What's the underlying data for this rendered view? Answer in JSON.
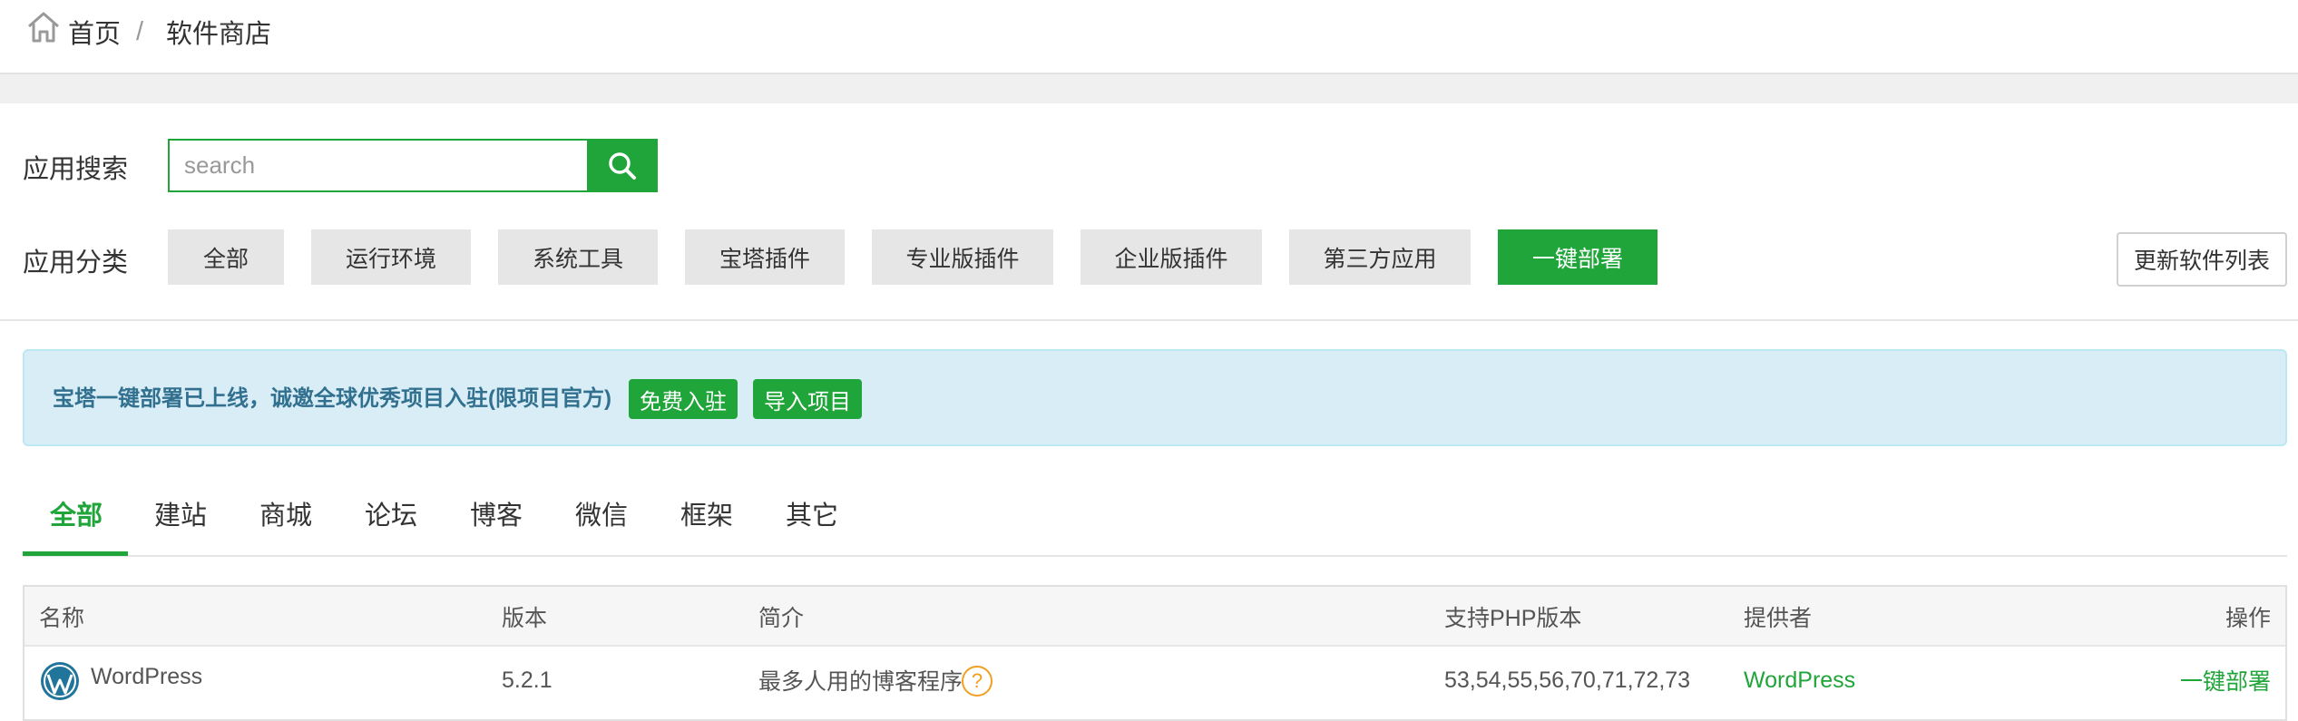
{
  "breadcrumb": {
    "home": "首页",
    "separator": "/",
    "current": "软件商店"
  },
  "search": {
    "label": "应用搜索",
    "placeholder": "search"
  },
  "categories": {
    "label": "应用分类",
    "items": [
      "全部",
      "运行环境",
      "系统工具",
      "宝塔插件",
      "专业版插件",
      "企业版插件",
      "第三方应用",
      "一键部署"
    ],
    "active": "一键部署"
  },
  "update_button": "更新软件列表",
  "banner": {
    "text": "宝塔一键部署已上线，诚邀全球优秀项目入驻(限项目官方)",
    "join_button": "免费入驻",
    "import_button": "导入项目"
  },
  "tabs": {
    "items": [
      "全部",
      "建站",
      "商城",
      "论坛",
      "博客",
      "微信",
      "框架",
      "其它"
    ],
    "active": "全部"
  },
  "table": {
    "headers": [
      "名称",
      "版本",
      "简介",
      "支持PHP版本",
      "提供者",
      "操作"
    ],
    "rows": [
      {
        "name": "WordPress",
        "version": "5.2.1",
        "description": "最多人用的博客程序",
        "php_versions": "53,54,55,56,70,71,72,73",
        "provider": "WordPress",
        "action": "一键部署"
      }
    ]
  },
  "colors": {
    "accent": "#20a53a",
    "banner_bg": "#d9edf7",
    "banner_text": "#31708f",
    "help_icon": "#f0a020"
  },
  "icons": [
    "home-icon",
    "search-icon",
    "help-icon",
    "wordpress-logo"
  ]
}
